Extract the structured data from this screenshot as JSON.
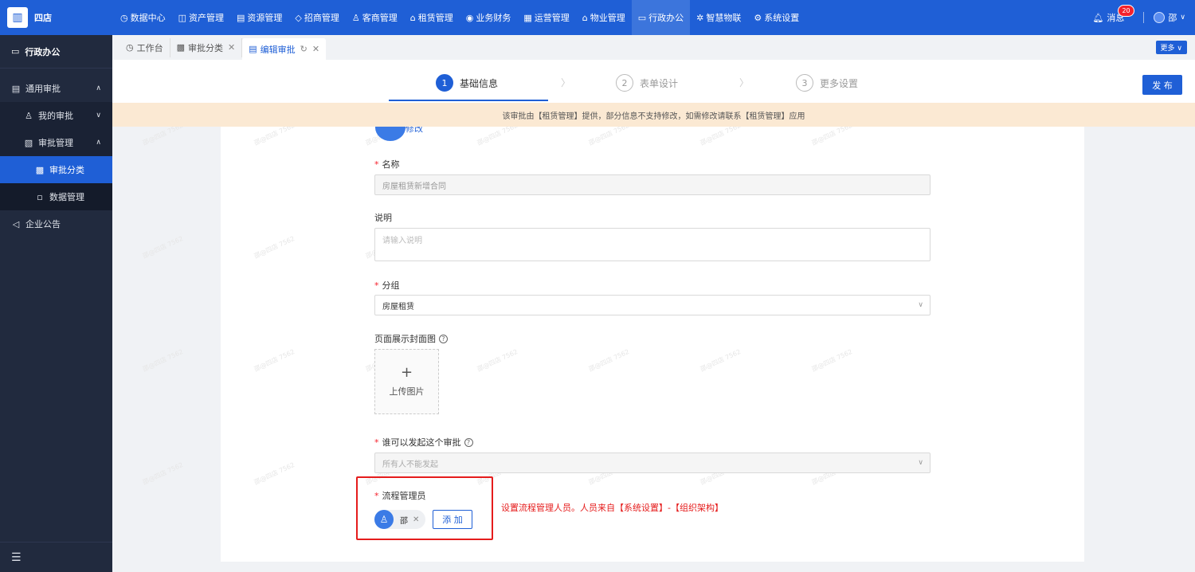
{
  "brand": {
    "name": "四店"
  },
  "topnav": [
    {
      "label": "数据中心",
      "icon": "◷"
    },
    {
      "label": "资产管理",
      "icon": "◫"
    },
    {
      "label": "资源管理",
      "icon": "▤"
    },
    {
      "label": "招商管理",
      "icon": "◇"
    },
    {
      "label": "客商管理",
      "icon": "♙"
    },
    {
      "label": "租赁管理",
      "icon": "⌂"
    },
    {
      "label": "业务财务",
      "icon": "◉"
    },
    {
      "label": "运营管理",
      "icon": "▦"
    },
    {
      "label": "物业管理",
      "icon": "⌂"
    },
    {
      "label": "行政办公",
      "icon": "▭"
    },
    {
      "label": "智慧物联",
      "icon": "✲"
    },
    {
      "label": "系统设置",
      "icon": "⚙"
    }
  ],
  "topnav_active_index": 9,
  "header": {
    "messages_label": "消息",
    "messages_count": "20",
    "user_name": "邵"
  },
  "sidebar": {
    "title": "行政办公",
    "items": [
      {
        "label": "通用审批",
        "icon": "▤"
      },
      {
        "label": "我的审批",
        "icon": "♙"
      },
      {
        "label": "审批管理",
        "icon": "▧"
      },
      {
        "label": "审批分类",
        "icon": "▩"
      },
      {
        "label": "数据管理",
        "icon": "▫"
      },
      {
        "label": "企业公告",
        "icon": "◁"
      }
    ],
    "collapse_icon": "☰"
  },
  "tabs": [
    {
      "label": "工作台",
      "icon": "◷"
    },
    {
      "label": "审批分类",
      "icon": "▩"
    },
    {
      "label": "编辑审批",
      "icon": "▤"
    }
  ],
  "more_label": "更多 ∨",
  "steps": [
    {
      "num": "1",
      "label": "基础信息"
    },
    {
      "num": "2",
      "label": "表单设计"
    },
    {
      "num": "3",
      "label": "更多设置"
    }
  ],
  "publish_label": "发 布",
  "notice": "该审批由【租赁管理】提供，部分信息不支持修改，如需修改请联系【租赁管理】应用",
  "form": {
    "icon_label": "修改",
    "name_label": "名称",
    "name_value": "房屋租赁新增合同",
    "desc_label": "说明",
    "desc_placeholder": "请输入说明",
    "group_label": "分组",
    "group_value": "房屋租赁",
    "cover_label": "页面展示封面图",
    "upload_plus": "+",
    "upload_label": "上传图片",
    "initiator_label": "谁可以发起这个审批",
    "initiator_value": "所有人不能发起",
    "admin_label": "流程管理员",
    "admin_user": "邵",
    "add_label": "添 加"
  },
  "annotation": "设置流程管理人员。人员来自【系统设置】-【组织架构】",
  "watermark": "邵@四店 7562",
  "colors": {
    "primary": "#1f5fd6",
    "sidebar": "#212a3e",
    "notice_bg": "#fbe9d3",
    "annotation": "#e51c1c"
  }
}
